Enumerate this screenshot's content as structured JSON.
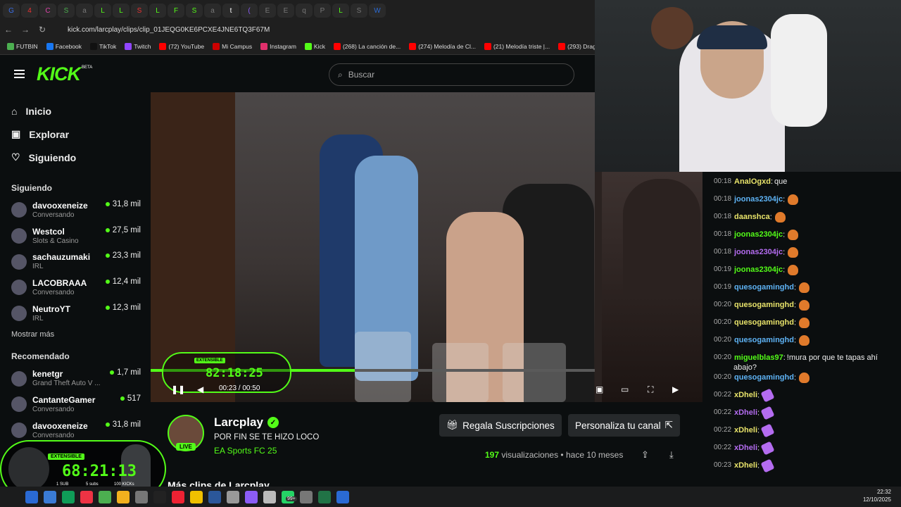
{
  "browser": {
    "url": "kick.com/larcplay/clips/clip_01JEQG0KE6PCXE4JNE6TQ3F67M",
    "tabs": [
      "G",
      "4",
      "C",
      "S",
      "a",
      "L",
      "L",
      "S",
      "L",
      "F",
      "S",
      "a",
      "t",
      "(",
      "E",
      "E",
      "q",
      "P",
      "L",
      "S",
      "W"
    ],
    "bookmarks": [
      "FUTBIN",
      "Facebook",
      "TikTok",
      "Twitch",
      "(72) YouTube",
      "Mi Campus",
      "Instagram",
      "Kick",
      "(268) La canción de...",
      "(274) Melodía de Cl...",
      "(21) Melodía triste |...",
      "(293) Drag"
    ]
  },
  "header": {
    "logo": "KICK",
    "beta": "BETA",
    "search_placeholder": "Buscar"
  },
  "sidebar": {
    "nav": [
      {
        "label": "Inicio",
        "icon": "home-icon"
      },
      {
        "label": "Explorar",
        "icon": "compass-icon"
      },
      {
        "label": "Siguiendo",
        "icon": "heart-icon"
      }
    ],
    "following_title": "Siguiendo",
    "following": [
      {
        "name": "davooxeneize",
        "sub": "Conversando",
        "viewers": "31,8 mil"
      },
      {
        "name": "Westcol",
        "sub": "Slots & Casino",
        "viewers": "27,5 mil"
      },
      {
        "name": "sachauzumaki",
        "sub": "IRL",
        "viewers": "23,3 mil"
      },
      {
        "name": "LACOBRAAA",
        "sub": "Conversando",
        "viewers": "12,4 mil"
      },
      {
        "name": "NeutroYT",
        "sub": "IRL",
        "viewers": "12,3 mil"
      }
    ],
    "show_more": "Mostrar más",
    "recommended_title": "Recomendado",
    "recommended": [
      {
        "name": "kenetgr",
        "sub": "Grand Theft Auto V ...",
        "viewers": "1,7 mil"
      },
      {
        "name": "CantanteGamer",
        "sub": "Conversando",
        "viewers": "517"
      },
      {
        "name": "davooxeneize",
        "sub": "Conversando",
        "viewers": "31,8 mil"
      }
    ]
  },
  "player": {
    "time": "00:23 / 00:50",
    "progress": 0.46,
    "overlay_badge": "EXTENSIBLE",
    "overlay_time": "82:18:25"
  },
  "channel": {
    "name": "Larcplay",
    "live": "LIVE",
    "clip_title": "POR FIN SE TE HIZO LOCO",
    "game": "EA Sports FC 25",
    "gift_button": "Regala Suscripciones",
    "customize_button": "Personaliza tu canal",
    "views_count": "197",
    "views_label": "visualizaciones",
    "age": "hace 10 meses",
    "more_clips": "Más clips de Larcplay"
  },
  "chat": [
    {
      "t": "00:18",
      "u": "AnalOgxd",
      "c": "#e8e36a",
      "m": "que",
      "e": ""
    },
    {
      "t": "00:18",
      "u": "joonas2304jc",
      "c": "#5eb3f5",
      "m": "",
      "e": "o"
    },
    {
      "t": "00:18",
      "u": "daanshca",
      "c": "#e8e36a",
      "m": "",
      "e": "o"
    },
    {
      "t": "00:18",
      "u": "joonas2304jc",
      "c": "#53fc18",
      "m": "",
      "e": "o"
    },
    {
      "t": "00:18",
      "u": "joonas2304jc",
      "c": "#b46cf0",
      "m": "",
      "e": "o"
    },
    {
      "t": "00:19",
      "u": "joonas2304jc",
      "c": "#53fc18",
      "m": "",
      "e": "o"
    },
    {
      "t": "00:19",
      "u": "quesogaminghd",
      "c": "#5eb3f5",
      "m": "",
      "e": "o"
    },
    {
      "t": "00:20",
      "u": "quesogaminghd",
      "c": "#e8e36a",
      "m": "",
      "e": "o"
    },
    {
      "t": "00:20",
      "u": "quesogaminghd",
      "c": "#e8e36a",
      "m": "",
      "e": "o"
    },
    {
      "t": "00:20",
      "u": "quesogaminghd",
      "c": "#5eb3f5",
      "m": "",
      "e": "o"
    },
    {
      "t": "00:20",
      "u": "miguelblas97",
      "c": "#53fc18",
      "m": "!mura por que te tapas ahí abajo?",
      "e": ""
    },
    {
      "t": "00:20",
      "u": "quesogaminghd",
      "c": "#5eb3f5",
      "m": "",
      "e": "o"
    },
    {
      "t": "00:22",
      "u": "xDheli",
      "c": "#e8e36a",
      "m": "",
      "e": "p"
    },
    {
      "t": "00:22",
      "u": "xDheli",
      "c": "#b46cf0",
      "m": "",
      "e": "p"
    },
    {
      "t": "00:22",
      "u": "xDheli",
      "c": "#e8e36a",
      "m": "",
      "e": "p"
    },
    {
      "t": "00:22",
      "u": "xDheli",
      "c": "#b46cf0",
      "m": "",
      "e": "p"
    },
    {
      "t": "00:23",
      "u": "xDheli",
      "c": "#e8e36a",
      "m": "",
      "e": "p"
    }
  ],
  "overlay": {
    "badge": "EXTENSIBLE",
    "time": "68:21:13",
    "sub1": "1 SUB\n30 MINUTES",
    "sub2": "5 subs\n20 MIN",
    "sub3": "100 KICKs\n15 MIN"
  },
  "taskbar": {
    "time": "22:32",
    "date": "12/10/2025",
    "badge": "99+"
  }
}
